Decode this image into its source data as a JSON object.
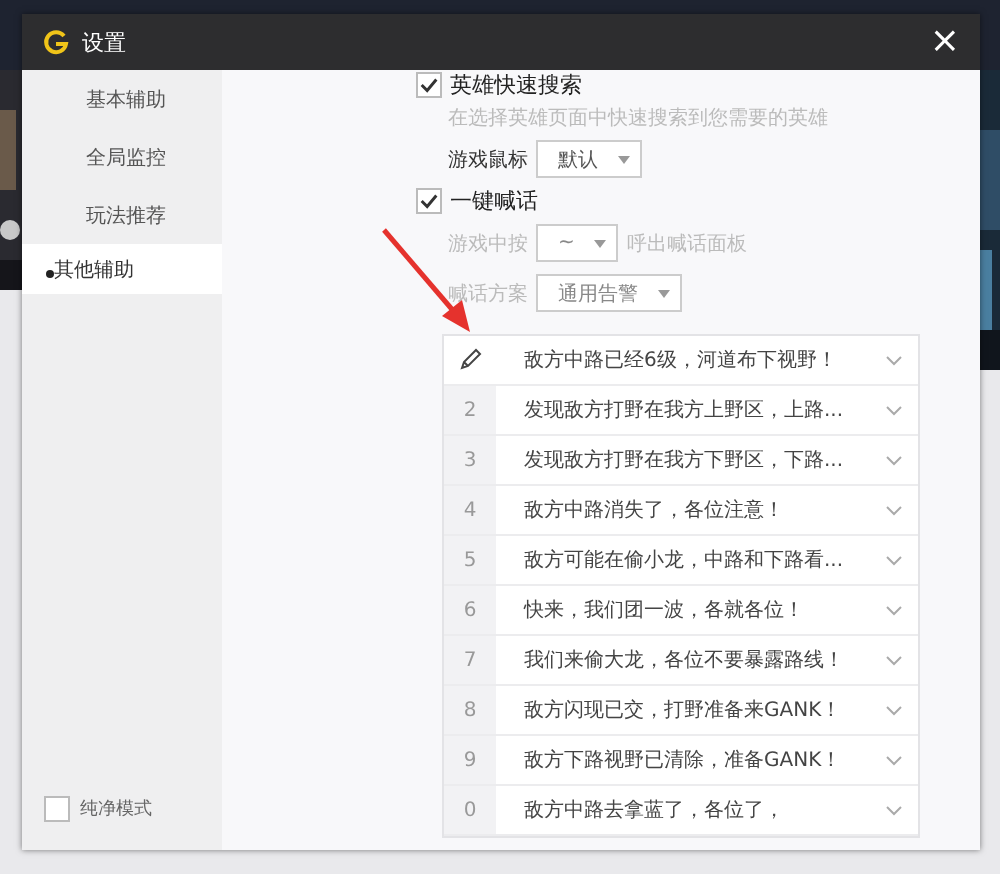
{
  "window": {
    "title": "设置",
    "close": "×"
  },
  "sidebar": {
    "items": [
      {
        "label": "基本辅助",
        "selected": false
      },
      {
        "label": "全局监控",
        "selected": false
      },
      {
        "label": "玩法推荐",
        "selected": false
      },
      {
        "label": "其他辅助",
        "selected": true
      }
    ],
    "pure_mode": {
      "label": "纯净模式",
      "checked": false
    }
  },
  "settings": [
    {
      "kind": "check",
      "label": "英雄快速搜索",
      "checked": true
    },
    {
      "kind": "hint",
      "text": "在选择英雄页面中快速搜索到您需要的英雄"
    },
    {
      "kind": "select",
      "label": "游戏鼠标",
      "value": "默认",
      "disabled": false
    },
    {
      "kind": "check",
      "label": "一键喊话",
      "checked": true
    },
    {
      "kind": "select",
      "label": "游戏中按",
      "value": "~",
      "suffix": "呼出喊话面板",
      "disabled": true
    },
    {
      "kind": "select",
      "label": "喊话方案",
      "value": "通用告警",
      "disabled": true
    }
  ],
  "phrases": [
    {
      "text": "敌方中路已经6级，河道布下视野！",
      "editing": true
    },
    {
      "key": "2",
      "text": "发现敌方打野在我方上野区，上路...",
      "editing": false
    },
    {
      "key": "3",
      "text": "发现敌方打野在我方下野区，下路...",
      "editing": false
    },
    {
      "key": "4",
      "text": "敌方中路消失了，各位注意！",
      "editing": false
    },
    {
      "key": "5",
      "text": "敌方可能在偷小龙，中路和下路看...",
      "editing": false
    },
    {
      "key": "6",
      "text": "快来，我们团一波，各就各位！",
      "editing": false
    },
    {
      "key": "7",
      "text": "我们来偷大龙，各位不要暴露路线！",
      "editing": false
    },
    {
      "key": "8",
      "text": "敌方闪现已交，打野准备来GANK！",
      "editing": false
    },
    {
      "key": "9",
      "text": "敌方下路视野已清除，准备GANK！",
      "editing": false
    },
    {
      "key": "0",
      "text": "敌方中路去拿蓝了，各位了，",
      "editing": false
    }
  ]
}
